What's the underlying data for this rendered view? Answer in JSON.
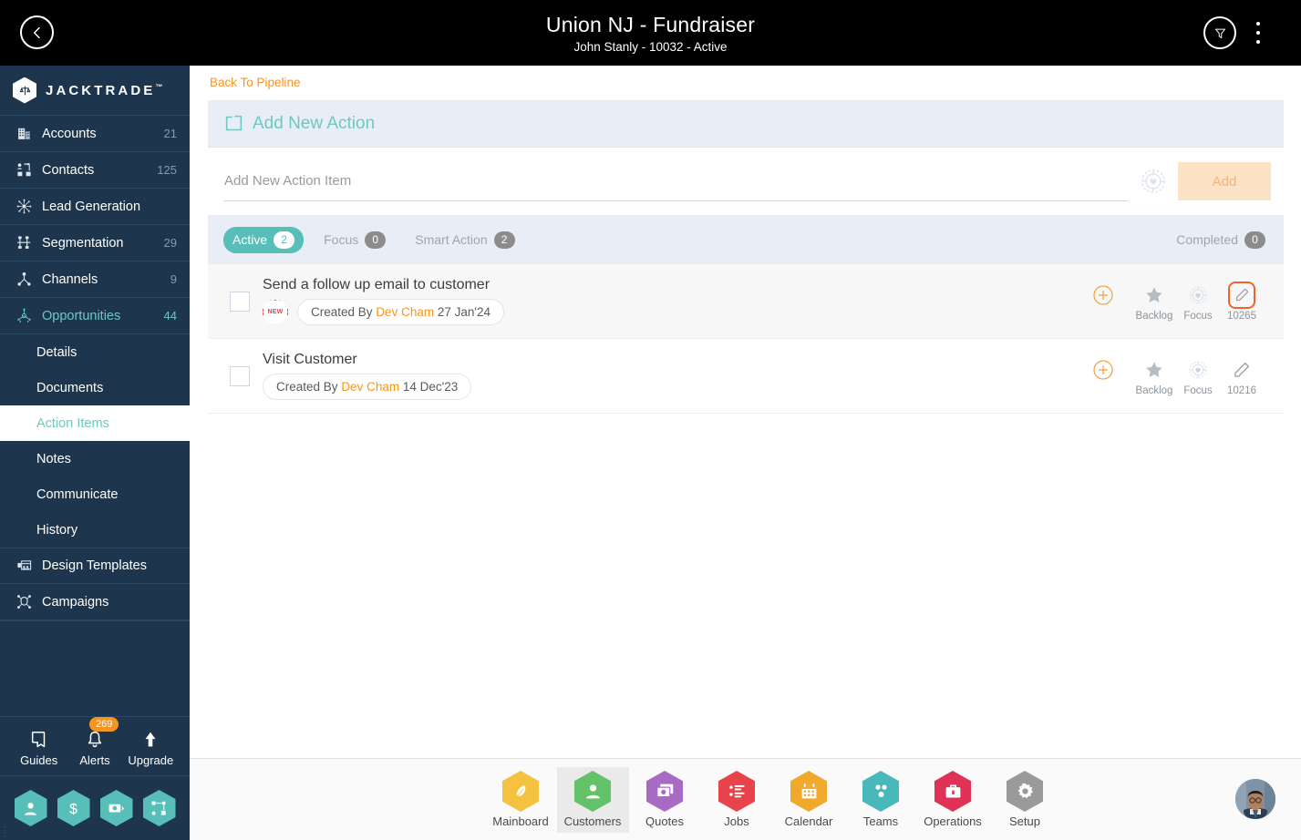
{
  "topbar": {
    "title": "Union NJ - Fundraiser",
    "subtitle": "John Stanly - 10032 - Active",
    "back_label": "Back",
    "filter_label": "Filter",
    "menu_label": "More options"
  },
  "sidebar": {
    "brand": "JACKTRADE",
    "brand_tm": "™",
    "items": [
      {
        "label": "Accounts",
        "count": "21",
        "icon": "building-icon",
        "active": false
      },
      {
        "label": "Contacts",
        "count": "125",
        "icon": "contacts-icon",
        "active": false
      },
      {
        "label": "Lead Generation",
        "count": "",
        "icon": "lead-generation-icon",
        "active": false
      },
      {
        "label": "Segmentation",
        "count": "29",
        "icon": "segmentation-icon",
        "active": false
      },
      {
        "label": "Channels",
        "count": "9",
        "icon": "channels-icon",
        "active": false
      },
      {
        "label": "Opportunities",
        "count": "44",
        "icon": "opportunities-icon",
        "active": true
      }
    ],
    "sub_items": [
      {
        "label": "Details",
        "selected": false
      },
      {
        "label": "Documents",
        "selected": false
      },
      {
        "label": "Action Items",
        "selected": true
      },
      {
        "label": "Notes",
        "selected": false
      },
      {
        "label": "Communicate",
        "selected": false
      },
      {
        "label": "History",
        "selected": false
      }
    ],
    "items_after": [
      {
        "label": "Design Templates",
        "count": "",
        "icon": "design-templates-icon",
        "active": false
      },
      {
        "label": "Campaigns",
        "count": "",
        "icon": "campaigns-icon",
        "active": false
      }
    ],
    "tools": [
      {
        "label": "Guides",
        "icon": "book-icon",
        "badge": ""
      },
      {
        "label": "Alerts",
        "icon": "bell-icon",
        "badge": "269"
      },
      {
        "label": "Upgrade",
        "icon": "upgrade-arrow-icon",
        "badge": ""
      }
    ],
    "hex_shortcuts": [
      {
        "icon": "person-icon"
      },
      {
        "icon": "dollar-icon"
      },
      {
        "icon": "money-transfer-icon"
      },
      {
        "icon": "workflow-icon"
      }
    ],
    "accent_color": "#57bfb8",
    "background_color": "#1d364d"
  },
  "main": {
    "back_to_pipeline": "Back To Pipeline",
    "panel_title": "Add New Action",
    "panel_icon": "add-to-box-icon",
    "add_input_placeholder": "Add New Action Item",
    "add_input_value": "",
    "target_icon": "target-heart-icon",
    "add_button_label": "Add",
    "tabs": [
      {
        "label": "Active",
        "count": "2",
        "active": true
      },
      {
        "label": "Focus",
        "count": "0",
        "active": false
      },
      {
        "label": "Smart Action",
        "count": "2",
        "active": false
      }
    ],
    "completed_tab": {
      "label": "Completed",
      "count": "0"
    },
    "action_items": [
      {
        "title": "Send a follow up email to customer",
        "badge": "NEW",
        "created_prefix": "Created By",
        "created_by": "Dev Cham",
        "created_date": "27 Jan'24",
        "backlog_label": "Backlog",
        "focus_label": "Focus",
        "id": "10265",
        "highlighted_edit": true,
        "shaded": true
      },
      {
        "title": "Visit Customer",
        "badge": "",
        "created_prefix": "Created By",
        "created_by": "Dev Cham",
        "created_date": "14 Dec'23",
        "backlog_label": "Backlog",
        "focus_label": "Focus",
        "id": "10216",
        "highlighted_edit": false,
        "shaded": false
      }
    ]
  },
  "bottombar": {
    "items": [
      {
        "label": "Mainboard",
        "color": "#f5c141",
        "icon": "feather-icon",
        "active": false
      },
      {
        "label": "Customers",
        "color": "#63c168",
        "icon": "person-icon",
        "active": true
      },
      {
        "label": "Quotes",
        "color": "#a86bc4",
        "icon": "quote-cards-icon",
        "active": false
      },
      {
        "label": "Jobs",
        "color": "#e8434a",
        "icon": "checklist-icon",
        "active": false
      },
      {
        "label": "Calendar",
        "color": "#f0a92c",
        "icon": "calendar-icon",
        "active": false
      },
      {
        "label": "Teams",
        "color": "#49b8bb",
        "icon": "teams-icon",
        "active": false
      },
      {
        "label": "Operations",
        "color": "#e03257",
        "icon": "briefcase-icon",
        "active": false
      },
      {
        "label": "Setup",
        "color": "#9a9a9a",
        "icon": "gear-icon",
        "active": false
      }
    ],
    "avatar_label": "User profile"
  }
}
